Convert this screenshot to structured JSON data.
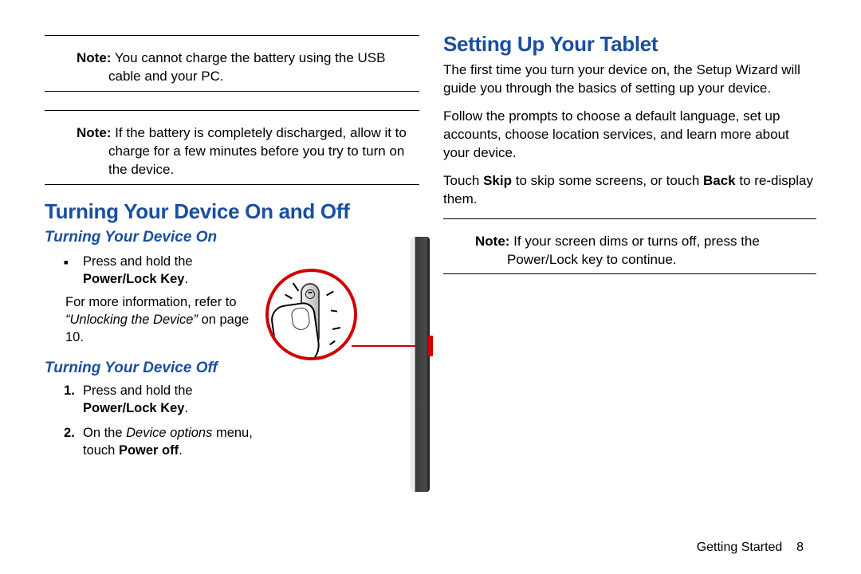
{
  "left": {
    "note1": {
      "label": "Note:",
      "text": " You cannot charge the battery using the USB cable and your PC."
    },
    "note2": {
      "label": "Note:",
      "text": " If the battery is completely discharged, allow it to charge for a few minutes before you try to turn on the device."
    },
    "h1": "Turning Your Device On and Off",
    "sub1": "Turning Your Device On",
    "bullet1": "Press and hold the ",
    "bullet1_bold": "Power/Lock Key",
    "bullet1_end": ".",
    "ref1": "For more information, refer to ",
    "ref1_ital": "“Unlocking the Device”",
    "ref1_end": " on page 10.",
    "sub2": "Turning Your Device Off",
    "step1": "Press and hold the ",
    "step1_bold": "Power/Lock Key",
    "step1_end": ".",
    "step2_a": "On the ",
    "step2_ital": "Device options",
    "step2_b": " menu, touch ",
    "step2_bold": "Power off",
    "step2_end": "."
  },
  "right": {
    "h1": "Setting Up Your Tablet",
    "p1": "The first time you turn your device on, the Setup Wizard will guide you through the basics of setting up your device.",
    "p2": "Follow the prompts to choose a default language, set up accounts, choose location services, and learn more about your device.",
    "p3_a": "Touch ",
    "p3_b1": "Skip",
    "p3_b": " to skip some screens, or touch ",
    "p3_b2": "Back",
    "p3_c": " to re-display them.",
    "note": {
      "label": "Note:",
      "text": " If your screen dims or turns off, press the Power/Lock key to continue."
    }
  },
  "footer": {
    "section": "Getting Started",
    "page": "8"
  }
}
